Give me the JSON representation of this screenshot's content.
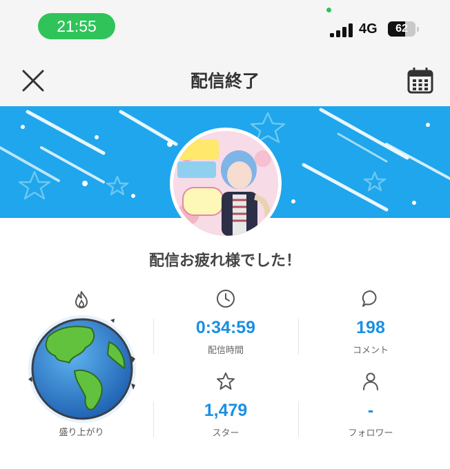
{
  "status_bar": {
    "time": "21:55",
    "network": "4G",
    "battery_level": "62",
    "battery_fraction": 0.62,
    "signal_bars": 4,
    "accent_green": "#2fc35a"
  },
  "header": {
    "title": "配信終了",
    "close_icon": "close-icon",
    "calendar_icon": "calendar-icon"
  },
  "banner": {
    "background_color": "#1fa6ec"
  },
  "summary": {
    "message": "配信お疲れ様でした！",
    "excitement_label": "盛り上がり",
    "excitement_icon": "flame-icon"
  },
  "stats": [
    {
      "icon": "clock-icon",
      "value": "0:34:59",
      "label": "配信時間"
    },
    {
      "icon": "comment-icon",
      "value": "198",
      "label": "コメント"
    },
    {
      "icon": "star-icon",
      "value": "1,479",
      "label": "スター"
    },
    {
      "icon": "person-icon",
      "value": "-",
      "label": "フォロワー"
    }
  ],
  "colors": {
    "value_blue": "#1a8fe3",
    "header_bg": "#f5f5f5"
  }
}
